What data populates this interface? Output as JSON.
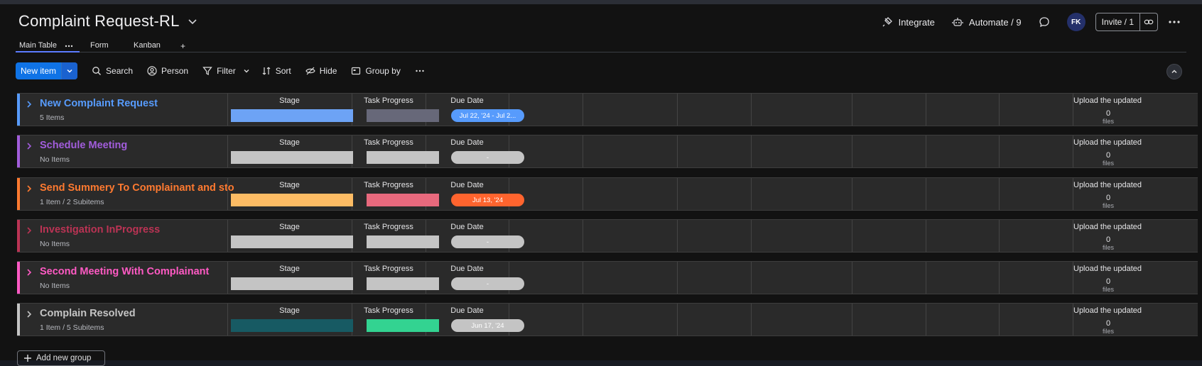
{
  "board": {
    "title": "Complaint Request-RL"
  },
  "header": {
    "integrate_label": "Integrate",
    "automate_label": "Automate / 9",
    "avatar_initials": "FK",
    "invite_label": "Invite / 1"
  },
  "tabs": [
    {
      "label": "Main Table",
      "active": true
    },
    {
      "label": "Form",
      "active": false
    },
    {
      "label": "Kanban",
      "active": false
    }
  ],
  "add_view_label": "+",
  "toolbar": {
    "new_item_label": "New item",
    "search_label": "Search",
    "person_label": "Person",
    "filter_label": "Filter",
    "sort_label": "Sort",
    "hide_label": "Hide",
    "group_by_label": "Group by"
  },
  "columns": {
    "stage": "Stage",
    "task_progress": "Task Progress",
    "due_date": "Due Date",
    "upload": "Upload the updated"
  },
  "files_label": "files",
  "groups": [
    {
      "name": "New Complaint Request",
      "count": "5 Items",
      "color": "#579bfc",
      "stage_color": "#6da3f5",
      "progress_color": "#676879",
      "due": "Jul 22, '24 - Jul 2...",
      "due_color": "#579bfc",
      "files": "0"
    },
    {
      "name": "Schedule Meeting",
      "count": "No Items",
      "color": "#a25ddc",
      "stage_color": "#c4c4c4",
      "progress_color": "#c4c4c4",
      "due": "-",
      "due_color": "#c4c4c4",
      "files": "0"
    },
    {
      "name": "Send Summery To Complainant and sto",
      "count": "1 Item / 2 Subitems",
      "color": "#ff7a30",
      "stage_color": "#fdbc64",
      "progress_color": "#e8697d",
      "due": "Jul 13, '24",
      "due_color": "#ff642e",
      "files": "0"
    },
    {
      "name": "Investigation InProgress",
      "count": "No Items",
      "color": "#bb3354",
      "stage_color": "#c4c4c4",
      "progress_color": "#c4c4c4",
      "due": "-",
      "due_color": "#c4c4c4",
      "files": "0"
    },
    {
      "name": "Second Meeting With Complainant",
      "count": "No Items",
      "color": "#ff5ac4",
      "stage_color": "#c4c4c4",
      "progress_color": "#c4c4c4",
      "due": "-",
      "due_color": "#c4c4c4",
      "files": "0"
    },
    {
      "name": "Complain Resolved",
      "count": "1 Item / 5 Subitems",
      "color": "#c4c4c4",
      "stage_color": "#175a63",
      "progress_color": "#33d391",
      "due": "Jun 17, '24",
      "due_color": "#c4c4c4",
      "files": "0"
    }
  ],
  "add_group_label": "Add new group"
}
